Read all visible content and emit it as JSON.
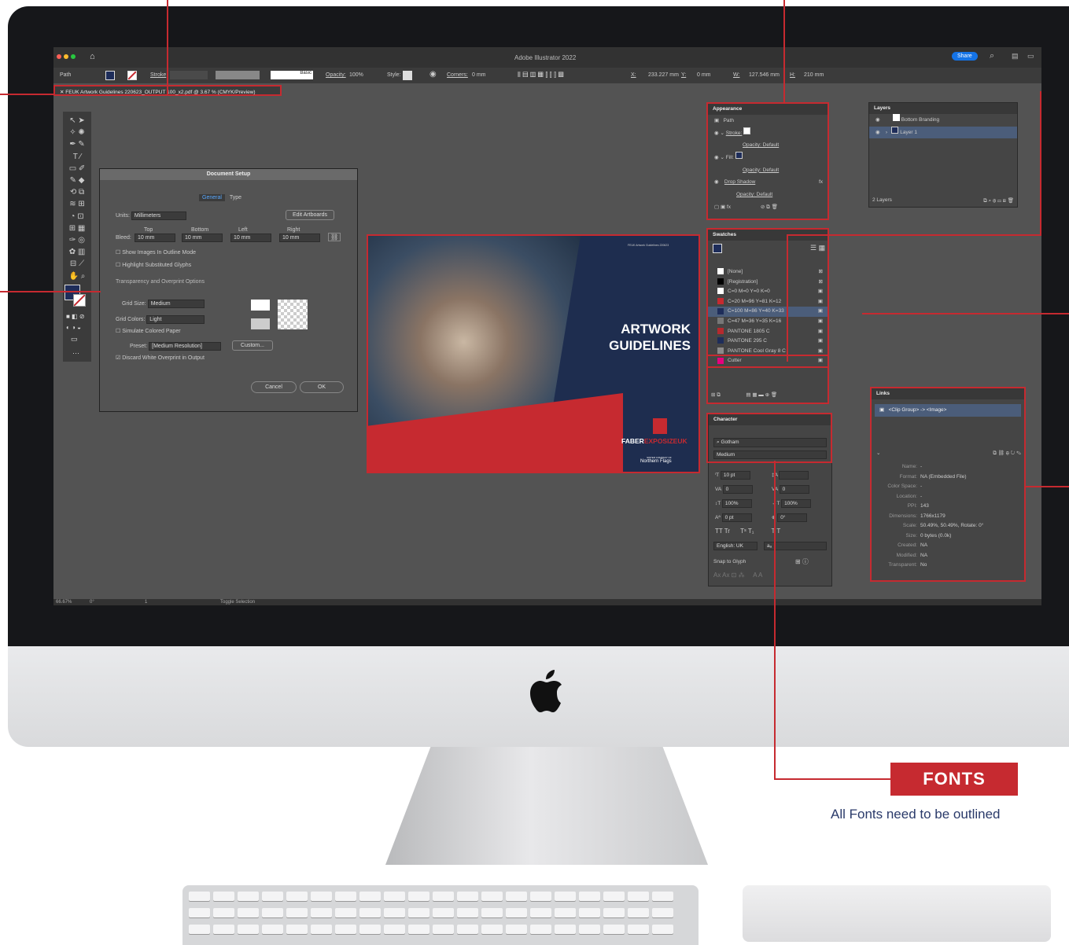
{
  "app": {
    "title": "Adobe Illustrator 2022",
    "share": "Share",
    "doc_tab": "FEUK Artwork Guidelines 220623_OUTPUT 100_x2.pdf @ 3.67 % (CMYK/Preview)"
  },
  "control_bar": {
    "selection": "Path",
    "stroke": "Stroke",
    "basic": "Basic",
    "opacity_label": "Opacity:",
    "opacity": "100%",
    "style": "Style:",
    "corners": "Corners:",
    "corners_val": "0 mm",
    "x_label": "X:",
    "x": "233.227 mm",
    "y_label": "Y:",
    "y": "0 mm",
    "w_label": "W:",
    "w": "127.546 mm",
    "h_label": "H:",
    "h": "210 mm"
  },
  "appearance": {
    "title": "Appearance",
    "path": "Path",
    "stroke": "Stroke:",
    "opacity1": "Opacity: Default",
    "fill": "Fill:",
    "opacity2": "Opacity: Default",
    "drop_shadow": "Drop Shadow",
    "opacity3": "Opacity: Default"
  },
  "layers": {
    "title": "Layers",
    "items": [
      "Bottom Branding",
      "Layer 1"
    ],
    "count": "2 Layers"
  },
  "swatches": {
    "title": "Swatches",
    "items": [
      "[None]",
      "[Registration]",
      "C=0 M=0 Y=0 K=0",
      "C=20 M=96 Y=81 K=12",
      "C=100 M=86 Y=40 K=33",
      "C=47 M=36 Y=35 K=16",
      "PANTONE 1805 C",
      "PANTONE 295 C",
      "PANTONE Cool Gray 8 C",
      "Cutter"
    ],
    "colors": [
      "#ffffff",
      "#000000",
      "#ffffff",
      "#c62a30",
      "#1e2d5a",
      "#777777",
      "#b52a2e",
      "#1e2d5a",
      "#8a8a8a",
      "#e6007e"
    ]
  },
  "links": {
    "title": "Links",
    "item": "<Clip Group> -> <Image>",
    "labels": [
      "Name:",
      "Format:",
      "Color Space:",
      "Location:",
      "PPI:",
      "Dimensions:",
      "Scale:",
      "Size:",
      "Created:",
      "Modified:",
      "Transparent:"
    ],
    "values": [
      "-",
      "NA (Embedded File)",
      "-",
      "-",
      "143",
      "1766x1179",
      "50.49%, 50.49%, Rotate: 0°",
      "0 bytes (0.0k)",
      "NA",
      "NA",
      "No"
    ]
  },
  "character": {
    "title": "Character",
    "font": "Gotham",
    "style": "Medium",
    "size": "10 pt",
    "leading": "",
    "tracking": "0",
    "kerning": "0",
    "vscale": "100%",
    "hscale": "100%",
    "baseline": "0 pt",
    "rotate": "0°",
    "language": "English: UK",
    "snap": "Snap to Glyph"
  },
  "document_setup": {
    "title": "Document Setup",
    "tab_general": "General",
    "tab_type": "Type",
    "units_label": "Units:",
    "units": "Millimeters",
    "edit_artboards": "Edit Artboards",
    "bleed_label": "Bleed:",
    "top_label": "Top",
    "bottom_label": "Bottom",
    "left_label": "Left",
    "right_label": "Right",
    "bleed_val": "10 mm",
    "outline_mode": "Show Images In Outline Mode",
    "substituted": "Highlight Substituted Glyphs",
    "transparency_title": "Transparency and Overprint Options",
    "grid_size_label": "Grid Size:",
    "grid_size": "Medium",
    "grid_colors_label": "Grid Colors:",
    "grid_colors": "Light",
    "simulate": "Simulate Colored Paper",
    "preset_label": "Preset:",
    "preset": "[Medium Resolution]",
    "custom": "Custom...",
    "discard": "Discard White Overprint in Output",
    "cancel": "Cancel",
    "ok": "OK"
  },
  "artwork": {
    "small": "FEUK Artwork Guidelines 220623",
    "title1": "ARTWORK",
    "title2": "GUIDELINES",
    "brand1": "FABER",
    "brand2": "EXPOSIZE",
    "brand3": "UK",
    "sister": "SISTER COMPANY OF",
    "northern": "Northern Flags"
  },
  "status": {
    "zoom": "66.67%",
    "angle": "0°",
    "page": "1",
    "toggle": "Toggle Selection"
  },
  "callout": {
    "label": "FONTS",
    "note": "All Fonts need to be outlined"
  }
}
